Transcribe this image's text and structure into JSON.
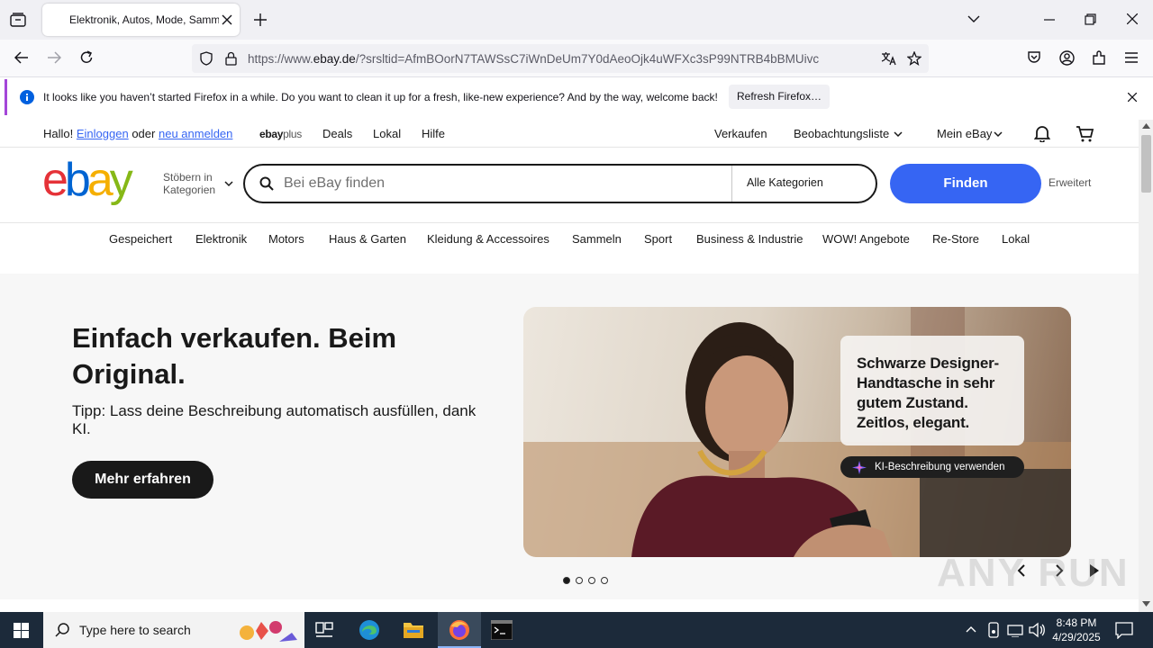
{
  "browser": {
    "tab_title": "Elektronik, Autos, Mode, Sammlerstücke",
    "url_prefix": "https://www.",
    "url_domain": "ebay.de",
    "url_rest": "/?srsltid=AfmBOorN7TAWSsC7iWnDeUm7Y0dAeoOjk4uWFXc3sP99NTRB4bBMUivc"
  },
  "notification": {
    "text": "It looks like you haven’t started Firefox in a while. Do you want to clean it up for a fresh, like-new experience? And by the way, welcome back!",
    "button": "Refresh Firefox…"
  },
  "topbar": {
    "greeting": "Hallo!",
    "signin": "Einloggen",
    "or": "oder",
    "register": "neu anmelden",
    "ebayplus_a": "ebay",
    "ebayplus_b": "plus",
    "deals": "Deals",
    "lokal": "Lokal",
    "hilfe": "Hilfe",
    "verkaufen": "Verkaufen",
    "watchlist": "Beobachtungsliste",
    "my_ebay": "Mein eBay"
  },
  "header": {
    "logo": [
      "e",
      "b",
      "a",
      "y"
    ],
    "browse_line1": "Stöbern in",
    "browse_line2": "Kategorien",
    "search_placeholder": "Bei eBay finden",
    "category": "Alle Kategorien",
    "find": "Finden",
    "advanced": "Erweitert"
  },
  "categories": [
    "Gespeichert",
    "Elektronik",
    "Motors",
    "Haus & Garten",
    "Kleidung & Accessoires",
    "Sammeln",
    "Sport",
    "Business & Industrie",
    "WOW! Angebote",
    "Re-Store",
    "Lokal"
  ],
  "hero": {
    "title": "Einfach verkaufen. Beim Original.",
    "subtitle": "Tipp: Lass deine Beschreibung automatisch ausfüllen, dank KI.",
    "button": "Mehr erfahren",
    "card_text": "Schwarze Designer-Handtasche in sehr gutem Zustand. Zeitlos, elegant.",
    "chip": "KI-Beschreibung verwenden",
    "slides": 4,
    "active_slide": 1
  },
  "taskbar": {
    "search": "Type here to search",
    "time": "8:48 PM",
    "date": "4/29/2025"
  },
  "watermark": "ANY RUN",
  "colors": {
    "ebay_red": "#e53238",
    "ebay_blue": "#0064d2",
    "ebay_yellow": "#f5af02",
    "ebay_green": "#86b817",
    "primary_blue": "#3665f3"
  }
}
